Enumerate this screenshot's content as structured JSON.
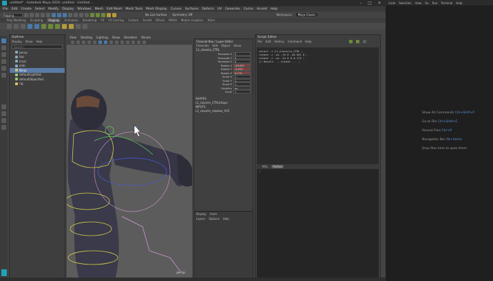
{
  "window": {
    "title": "untitled* - Autodesk Maya 2020: untitled - Untitled ...",
    "controls": [
      "–",
      "□",
      "×"
    ]
  },
  "menubar": [
    "File",
    "Edit",
    "Create",
    "Select",
    "Modify",
    "Display",
    "Windows",
    "Mesh",
    "Edit Mesh",
    "Mesh Tools",
    "Mesh Display",
    "Curves",
    "Surfaces",
    "Deform",
    "UV",
    "Generate",
    "Cache",
    "Arnold",
    "Help"
  ],
  "statusline": {
    "mode": "Rigging",
    "no_live_surface": "No Live Surface",
    "symmetry": "Symmetry: Off",
    "workspace_label": "Workspace:",
    "workspace_value": "Maya Classic"
  },
  "shelf_tabs": [
    "Poly Modeling",
    "Sculpting",
    "Rigging",
    "Animation",
    "Rendering",
    "FX",
    "FX Caching",
    "Custom",
    "Arnold",
    "Bifrost",
    "MASH",
    "Motion Graphics",
    "XGen"
  ],
  "shelf_tabs_active": "Rigging",
  "outliner": {
    "title": "Outliner",
    "menu": [
      "Display",
      "Show",
      "Help"
    ],
    "search_placeholder": "Search...",
    "items": [
      {
        "label": "persp",
        "selected": false
      },
      {
        "label": "top",
        "selected": false
      },
      {
        "label": "front",
        "selected": false
      },
      {
        "label": "side",
        "selected": false
      },
      {
        "label": "Ninja",
        "selected": true
      },
      {
        "label": "defaultLightSet",
        "selected": false
      },
      {
        "label": "defaultObjectSet",
        "selected": false
      },
      {
        "label": "rig",
        "selected": false
      }
    ]
  },
  "viewport": {
    "menu": [
      "View",
      "Shading",
      "Lighting",
      "Show",
      "Renderer",
      "Panels"
    ],
    "camera_label": "persp"
  },
  "channel_box": {
    "title": "Channel Box / Layer Editor",
    "tabs": [
      "Channels",
      "Edit",
      "Object",
      "Show"
    ],
    "object_name": "L1_clavicle_CTRL",
    "attributes": [
      {
        "name": "Translate X",
        "value": "0",
        "keyed": false
      },
      {
        "name": "Translate Y",
        "value": "0",
        "keyed": false
      },
      {
        "name": "Translate Z",
        "value": "0",
        "keyed": false
      },
      {
        "name": "Rotate X",
        "value": "-45.051",
        "keyed": true
      },
      {
        "name": "Rotate Y",
        "value": "-0.012",
        "keyed": true
      },
      {
        "name": "Rotate Z",
        "value": "0.173",
        "keyed": true
      },
      {
        "name": "Scale X",
        "value": "1",
        "keyed": false
      },
      {
        "name": "Scale Y",
        "value": "1",
        "keyed": false
      },
      {
        "name": "Scale Z",
        "value": "1",
        "keyed": false
      },
      {
        "name": "Visibility",
        "value": "on",
        "keyed": false
      },
      {
        "name": "Scale",
        "value": "1",
        "keyed": false
      }
    ],
    "sections": {
      "shapes": "SHAPES",
      "shape_name": "L1_clavicle_CTRLShape",
      "inputs": "INPUTS",
      "input_name": "L1_clavicle_rotation_XYZ"
    },
    "layer_box": {
      "tabs": [
        "Display",
        "Anim"
      ],
      "menu": [
        "Layers",
        "Options",
        "Help"
      ]
    }
  },
  "script_editor": {
    "title": "Script Editor",
    "menu": [
      "File",
      "Edit",
      "History",
      "Command",
      "Help"
    ],
    "history_lines": [
      "select -r L1_clavicle_CTRL ;",
      "rotate -r -os -fo 0 -45.051 0 ;",
      "rotate -r -os -fo 0 0 0.173 ;",
      "// Result: ...rotate ... ;"
    ],
    "input_tabs": [
      "MEL",
      "Python"
    ],
    "input_tab_active": "Python",
    "line_number": "1"
  },
  "side_panel": {
    "menu": [
      "Code",
      "Selection",
      "View",
      "Go",
      "Run",
      "Terminal",
      "Help"
    ],
    "hints": [
      {
        "label": "Show All Commands",
        "keys": "Ctrl+Shift+P"
      },
      {
        "label": "Go to File",
        "keys": "Ctrl+Shift+E"
      },
      {
        "label": "Recent Files",
        "keys": "Ctrl+R"
      },
      {
        "label": "Navigation Bar",
        "keys": "Alt+Home"
      },
      {
        "label": "Drop files here to open them",
        "keys": ""
      }
    ]
  },
  "colors": {
    "selection": "#5b7aa5",
    "keyed": "#8a3a3a",
    "hint_key": "#5d8fd0",
    "rig_yellow": "#d8d048",
    "rig_blue": "#4a5ae0",
    "rig_green": "#5cd05c",
    "rig_pink": "#e0a0e0"
  }
}
